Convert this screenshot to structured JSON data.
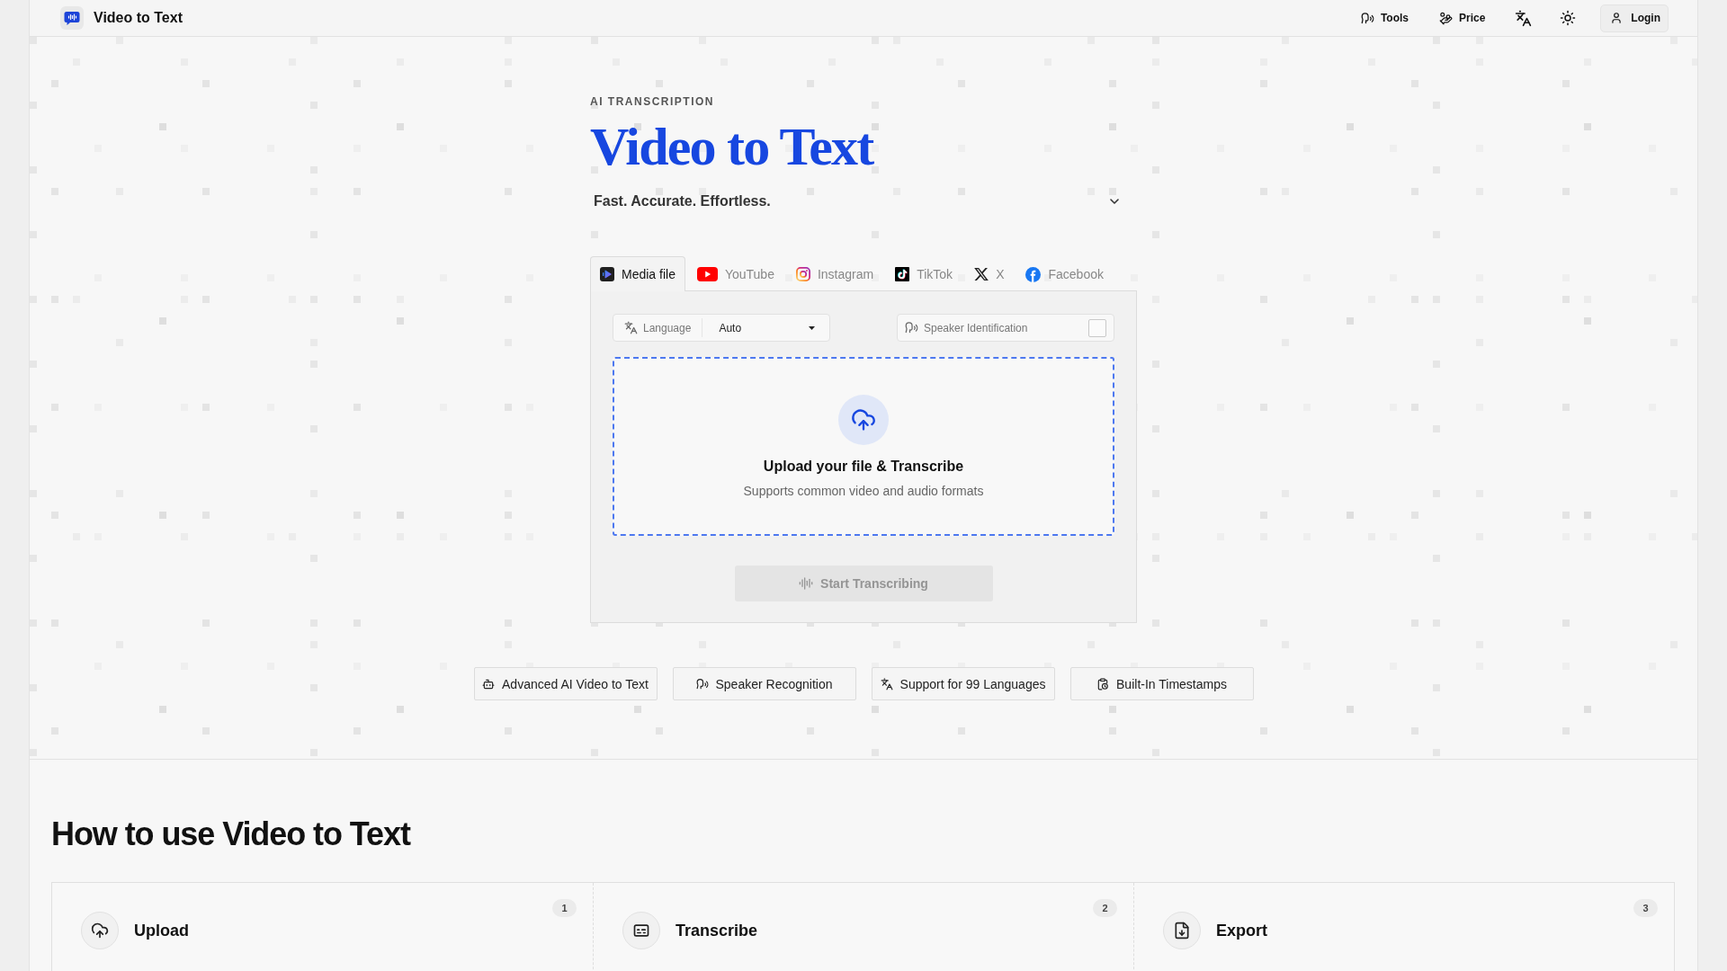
{
  "header": {
    "brand": "Video to Text",
    "nav": [
      {
        "label": "Tools"
      },
      {
        "label": "Price"
      }
    ],
    "login": "Login"
  },
  "hero": {
    "eyebrow": "AI TRANSCRIPTION",
    "title": "Video to Text",
    "tagline": "Fast. Accurate. Effortless.",
    "expanded": false
  },
  "tabs": [
    {
      "label": "Media file",
      "selected": true
    },
    {
      "label": "YouTube",
      "selected": false
    },
    {
      "label": "Instagram",
      "selected": false
    },
    {
      "label": "TikTok",
      "selected": false
    },
    {
      "label": "X",
      "selected": false
    },
    {
      "label": "Facebook",
      "selected": false
    }
  ],
  "options": {
    "language": {
      "label": "Language",
      "value": "Auto"
    },
    "speaker": {
      "label": "Speaker Identification",
      "checked": false
    }
  },
  "dropzone": {
    "title": "Upload your file & Transcribe",
    "subtitle": "Supports common video and audio formats"
  },
  "start_button": {
    "label": "Start Transcribing",
    "disabled": true
  },
  "features": [
    {
      "label": "Advanced AI Video to Text"
    },
    {
      "label": "Speaker Recognition"
    },
    {
      "label": "Support for 99 Languages"
    },
    {
      "label": "Built-In Timestamps"
    }
  ],
  "how_to": {
    "title": "How to use Video to Text",
    "steps": [
      {
        "number": "1",
        "title": "Upload"
      },
      {
        "number": "2",
        "title": "Transcribe"
      },
      {
        "number": "3",
        "title": "Export"
      }
    ]
  }
}
